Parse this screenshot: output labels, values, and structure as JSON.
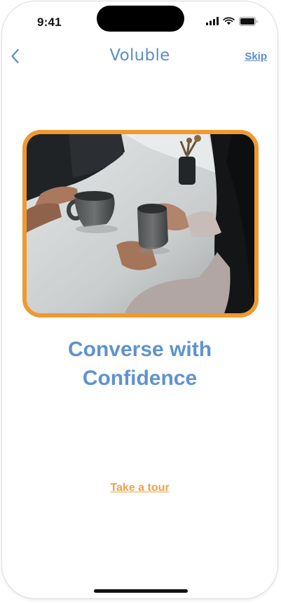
{
  "status_bar": {
    "time": "9:41",
    "icons": [
      "cellular-signal-icon",
      "wifi-icon",
      "battery-icon"
    ]
  },
  "nav": {
    "back_icon": "chevron-left-icon",
    "brand": "Voluble",
    "skip_label": "Skip"
  },
  "hero": {
    "image_subject": "two people holding coffee mugs at a white table"
  },
  "headline": {
    "line1": "Converse with",
    "line2": "Confidence"
  },
  "cta": {
    "tour_label": "Take a tour"
  },
  "colors": {
    "brand_blue": "#5b8ec9",
    "accent_orange": "#f0992f",
    "link_orange": "#eba34a",
    "background": "#ffffff"
  }
}
